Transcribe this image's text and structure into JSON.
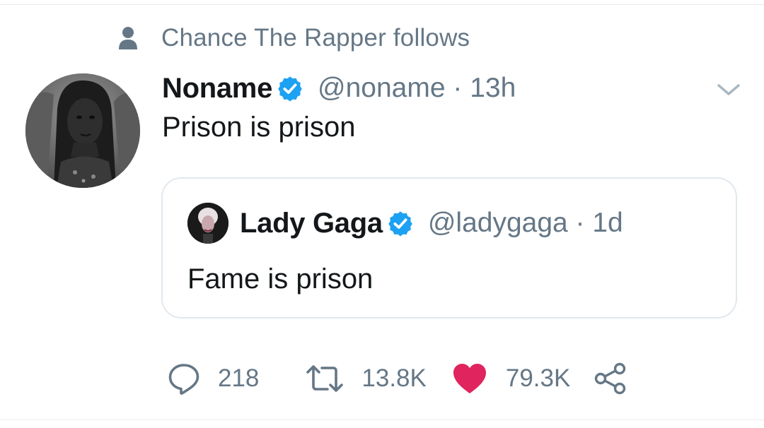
{
  "social_context": {
    "text": "Chance The Rapper follows",
    "icon": "person-icon"
  },
  "tweet": {
    "display_name": "Noname",
    "verified": true,
    "handle_time": "@noname · 13h",
    "text": "Prison is prison",
    "avatar_icon": "avatar-photo",
    "menu_icon": "chevron-down-icon"
  },
  "quoted_tweet": {
    "display_name": "Lady Gaga",
    "verified": true,
    "handle_time": "@ladygaga · 1d",
    "text": "Fame is prison"
  },
  "actions": {
    "reply_count": "218",
    "retweet_count": "13.8K",
    "like_count": "79.3K",
    "liked": true
  },
  "colors": {
    "secondary_text": "#657786",
    "primary_text": "#14171a",
    "verified_blue": "#1da1f2",
    "like_red": "#e0245e",
    "border": "#e1e8ed"
  }
}
